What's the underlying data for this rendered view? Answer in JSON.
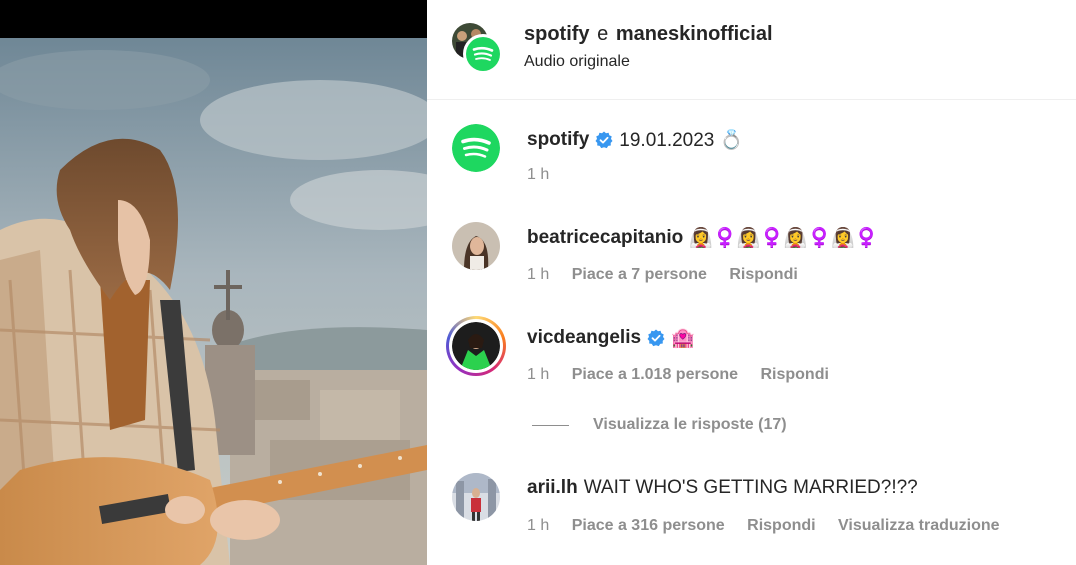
{
  "header": {
    "user1": "spotify",
    "joiner": "e",
    "user2": "maneskinofficial",
    "subtitle": "Audio originale"
  },
  "comments": [
    {
      "username": "spotify",
      "verified": true,
      "text": "19.01.2023 💍",
      "time": "1 h",
      "likes": "",
      "reply": ""
    },
    {
      "username": "beatricecapitanio",
      "verified": false,
      "text": "👰‍♀️♀️👰‍♀️♀️👰‍♀️♀️👰‍♀️♀️",
      "time": "1 h",
      "likes": "Piace a 7 persone",
      "reply": "Rispondi"
    },
    {
      "username": "vicdeangelis",
      "verified": true,
      "text": "🏩",
      "time": "1 h",
      "likes": "Piace a 1.018 persone",
      "reply": "Rispondi",
      "view_replies": "Visualizza le risposte (17)"
    },
    {
      "username": "arii.lh",
      "verified": false,
      "text": "WAIT WHO'S GETTING MARRIED?!??",
      "time": "1 h",
      "likes": "Piace a 316 persone",
      "reply": "Rispondi",
      "translate": "Visualizza traduzione"
    }
  ],
  "colors": {
    "spotify_green": "#1ed760",
    "verified_blue": "#3897f0",
    "muted_text": "#8e8e8e"
  }
}
